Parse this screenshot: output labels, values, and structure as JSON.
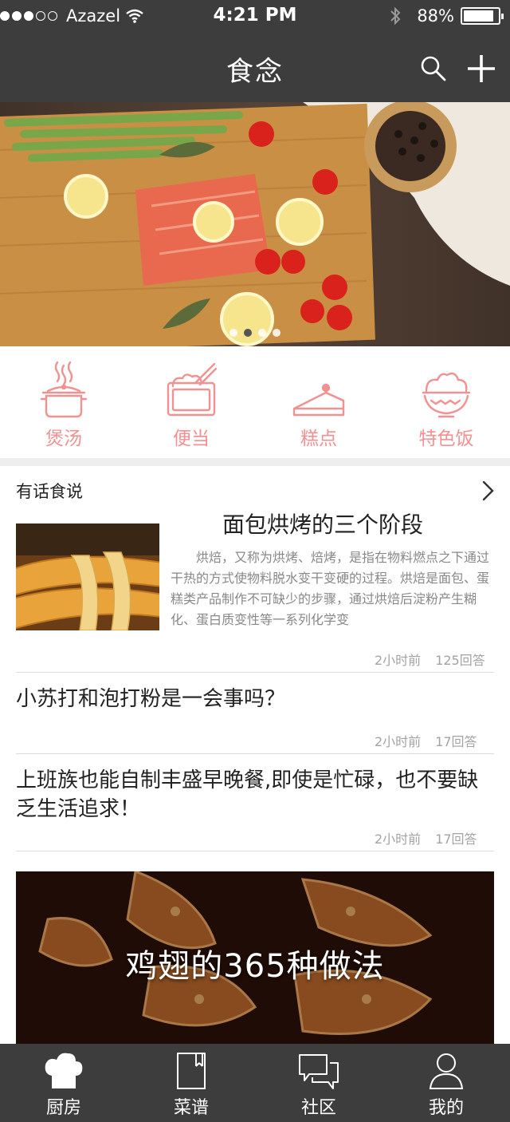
{
  "status_bar": {
    "carrier": "Azazel",
    "time": "4:21 PM",
    "battery": "88%",
    "battery_level": 0.88
  },
  "nav": {
    "title": "食念",
    "search_icon": "search-icon",
    "add_icon": "plus-icon"
  },
  "banner": {
    "slides": 4,
    "active_slide": 1
  },
  "categories": [
    {
      "label": "煲汤",
      "icon": "soup-pot-icon"
    },
    {
      "label": "便当",
      "icon": "bento-box-icon"
    },
    {
      "label": "糕点",
      "icon": "cake-slice-icon"
    },
    {
      "label": "特色饭",
      "icon": "rice-bowl-icon"
    }
  ],
  "colors": {
    "accent": "#f19191",
    "bar": "#3d3d3d"
  },
  "section": {
    "title": "有话食说"
  },
  "featured": {
    "title": "面包烘烤的三个阶段",
    "body": "烘焙，又称为烘烤、焙烤，是指在物料燃点之下通过干热的方式使物料脱水变干变硬的过程。烘焙是面包、蛋糕类产品制作不可缺少的步骤，通过烘焙后淀粉产生糊化、蛋白质变性等一系列化学变",
    "time": "2小时前",
    "answers": "125回答"
  },
  "posts": [
    {
      "title": "小苏打和泡打粉是一会事吗？",
      "time": "2小时前",
      "answers": "17回答"
    },
    {
      "title": "上班族也能自制丰盛早晚餐,即使是忙碌，也不要缺乏生活追求！",
      "time": "2小时前",
      "answers": "17回答"
    }
  ],
  "promo": {
    "title": "鸡翅的365种做法"
  },
  "tabs": [
    {
      "label": "厨房",
      "icon": "chef-hat-icon"
    },
    {
      "label": "菜谱",
      "icon": "recipe-book-icon"
    },
    {
      "label": "社区",
      "icon": "chat-bubbles-icon"
    },
    {
      "label": "我的",
      "icon": "user-icon"
    }
  ]
}
